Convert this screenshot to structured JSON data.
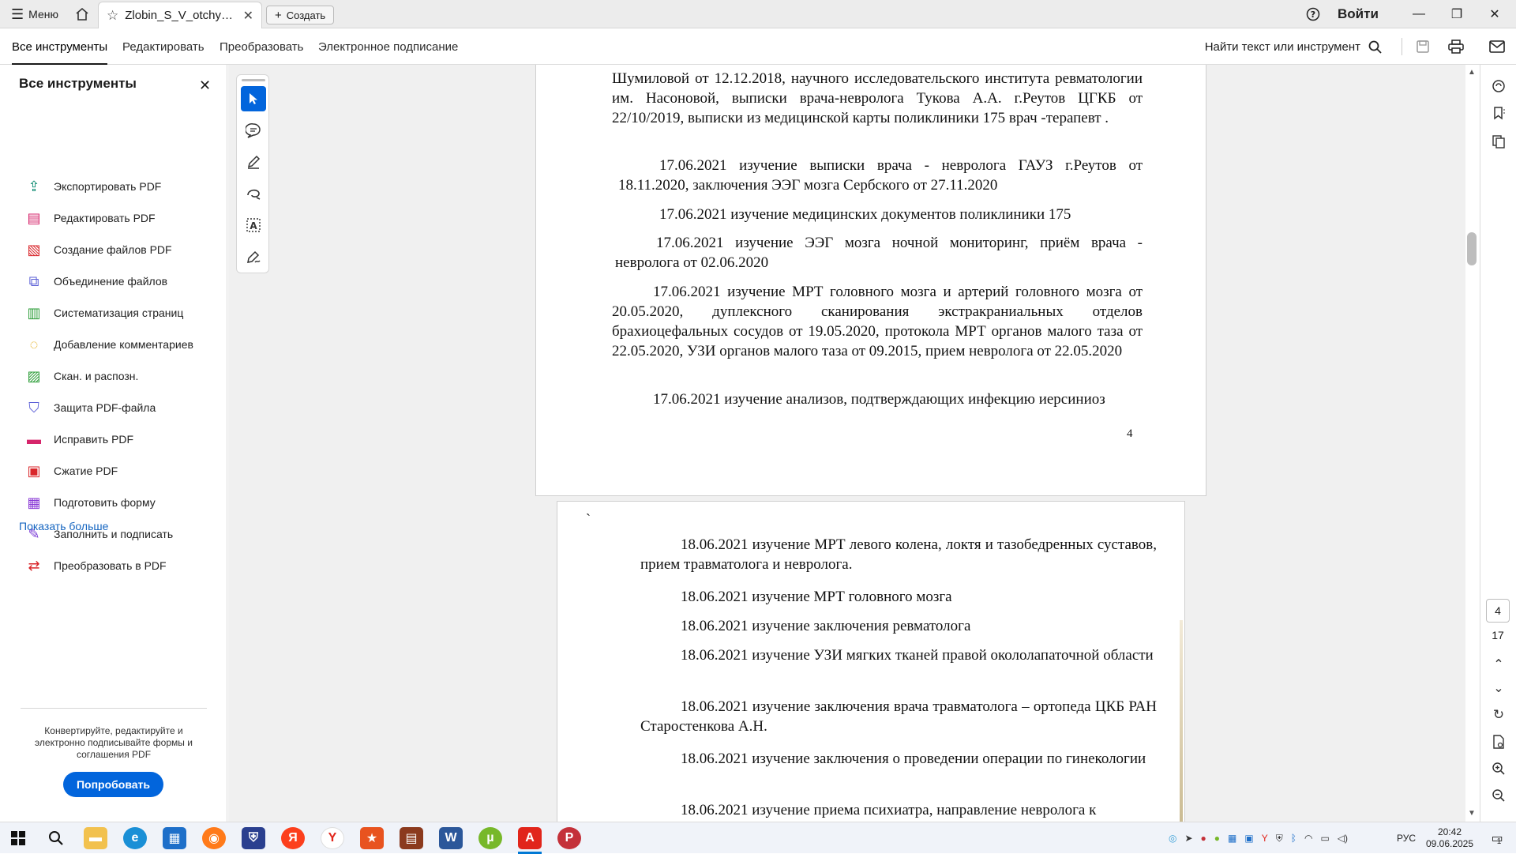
{
  "titlebar": {
    "menu_label": "Меню",
    "tab_title": "Zlobin_S_V_otchyot...",
    "new_label": "Создать",
    "signin_label": "Войти"
  },
  "toolbar": {
    "tabs": [
      "Все инструменты",
      "Редактировать",
      "Преобразовать",
      "Электронное подписание"
    ],
    "search_label": "Найти текст или инструмент"
  },
  "sidebar": {
    "title": "Все инструменты",
    "items": [
      {
        "label": "Экспортировать PDF",
        "icon": "export-pdf-icon",
        "color": "#0b8a6f"
      },
      {
        "label": "Редактировать PDF",
        "icon": "edit-pdf-icon",
        "color": "#d6256b"
      },
      {
        "label": "Создание файлов PDF",
        "icon": "create-pdf-icon",
        "color": "#d9262b"
      },
      {
        "label": "Объединение файлов",
        "icon": "combine-files-icon",
        "color": "#5b5fd6"
      },
      {
        "label": "Систематизация страниц",
        "icon": "organize-pages-icon",
        "color": "#2e9e3a"
      },
      {
        "label": "Добавление комментариев",
        "icon": "comment-icon",
        "color": "#e0a400"
      },
      {
        "label": "Скан. и распозн.",
        "icon": "scan-ocr-icon",
        "color": "#2e9e3a"
      },
      {
        "label": "Защита PDF-файла",
        "icon": "protect-pdf-icon",
        "color": "#5b5fd6"
      },
      {
        "label": "Исправить PDF",
        "icon": "redact-pdf-icon",
        "color": "#d6256b"
      },
      {
        "label": "Сжатие PDF",
        "icon": "compress-pdf-icon",
        "color": "#d9262b"
      },
      {
        "label": "Подготовить форму",
        "icon": "prepare-form-icon",
        "color": "#8a3ad6"
      },
      {
        "label": "Заполнить и подписать",
        "icon": "fill-sign-icon",
        "color": "#7a3ad6"
      },
      {
        "label": "Преобразовать в PDF",
        "icon": "convert-to-pdf-icon",
        "color": "#d9262b"
      }
    ],
    "show_more": "Показать больше",
    "promo_text": "Конвертируйте, редактируйте и электронно подписывайте формы и соглашения PDF",
    "try_button": "Попробовать"
  },
  "page1": {
    "paragraphs": [
      "Шумиловой от 12.12.2018, научного исследовательского института ревматологии им. Насоновой, выписки врача-невролога Тукова А.А. г.Реутов ЦГКБ от 22/10/2019, выписки из медицинской карты поликлиники 175 врач -терапевт .",
      "17.06.2021 изучение выписки врача - невролога ГАУЗ г.Реутов от 18.11.2020, заключения ЭЭГ мозга Сербского от 27.11.2020",
      "17.06.2021 изучение медицинских документов поликлиники 175",
      "17.06.2021 изучение ЭЭГ мозга ночной мониторинг, приём врача - невролога от 02.06.2020",
      "17.06.2021 изучение МРТ головного мозга и артерий головного мозга от 20.05.2020, дуплексного сканирования экстракраниальных отделов брахиоцефальных сосудов от 19.05.2020, протокола МРТ органов малого таза от 22.05.2020, УЗИ органов малого таза от 09.2015, прием невролога от 22.05.2020",
      "17.06.2021 изучение анализов, подтверждающих инфекцию иерсиниоз"
    ],
    "page_number": "4"
  },
  "page2": {
    "paragraphs": [
      "18.06.2021 изучение МРТ левого колена, локтя и тазобедренных суставов, прием травматолога и невролога.",
      "18.06.2021 изучение МРТ головного мозга",
      "18.06.2021 изучение заключения ревматолога",
      "18.06.2021 изучение УЗИ мягких тканей правой окололапаточной области",
      "18.06.2021 изучение заключения врача травматолога – ортопеда ЦКБ РАН Старостенкова А.Н.",
      "18.06.2021 изучение заключения о проведении операции по гинекологии",
      "18.06.2021 изучение приема психиатра, направление невролога к"
    ]
  },
  "navigation": {
    "current_page": "4",
    "total_pages": "17"
  },
  "taskbar": {
    "language": "РУС",
    "time": "20:42",
    "date": "09.06.2025",
    "notification_count": "1"
  },
  "colors": {
    "accent": "#0265dc",
    "link": "#1565c0"
  }
}
